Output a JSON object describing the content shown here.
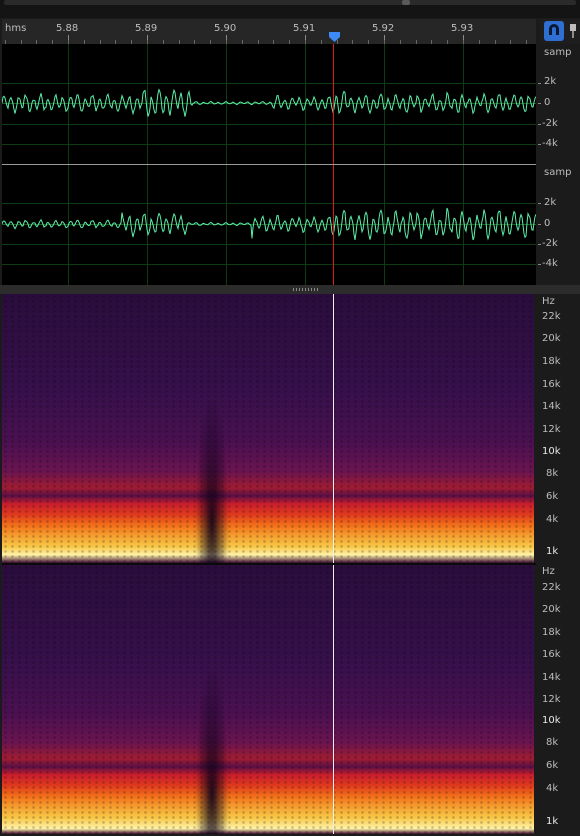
{
  "ruler": {
    "unit": "hms",
    "ticks": [
      "5.88",
      "5.89",
      "5.90",
      "5.91",
      "5.92",
      "5.93"
    ]
  },
  "waveform": {
    "channels": [
      {
        "unit": "samp",
        "labels": [
          "2k",
          "0",
          "-2k",
          "-4k"
        ]
      },
      {
        "unit": "samp",
        "labels": [
          "2k",
          "0",
          "-2k",
          "-4k"
        ]
      }
    ]
  },
  "spectrogram": {
    "channels": [
      {
        "unit": "Hz",
        "labels": [
          "22k",
          "20k",
          "18k",
          "16k",
          "14k",
          "12k",
          "10k",
          "8k",
          "6k",
          "4k",
          "1k"
        ]
      },
      {
        "unit": "Hz",
        "labels": [
          "22k",
          "20k",
          "18k",
          "16k",
          "14k",
          "12k",
          "10k",
          "8k",
          "6k",
          "4k",
          "1k"
        ]
      }
    ]
  },
  "tools": {
    "icons": [
      "snap-magnet-icon",
      "pin-icon"
    ]
  },
  "colors": {
    "waveform": "#5cf0a8",
    "playhead": "#e01818",
    "accent": "#3d8bf2"
  }
}
